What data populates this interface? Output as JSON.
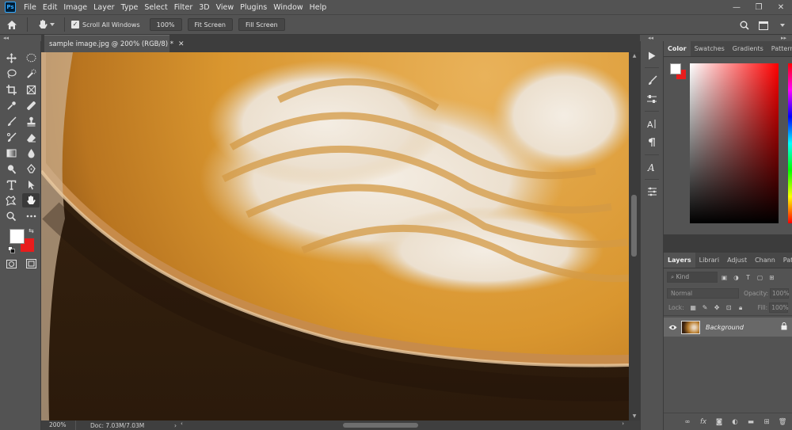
{
  "app": {
    "logo": "Ps"
  },
  "menu": [
    "File",
    "Edit",
    "Image",
    "Layer",
    "Type",
    "Select",
    "Filter",
    "3D",
    "View",
    "Plugins",
    "Window",
    "Help"
  ],
  "window_controls": {
    "minimize": "—",
    "restore": "❐",
    "close": "✕"
  },
  "options": {
    "scroll_all_label": "Scroll All Windows",
    "zoom_100": "100%",
    "fit_screen": "Fit Screen",
    "fill_screen": "Fill Screen"
  },
  "collapse": {
    "left": "◂◂",
    "right": "▸▸"
  },
  "document": {
    "tab_title": "sample image.jpg @ 200% (RGB/8) *",
    "close": "✕"
  },
  "status": {
    "zoom": "200%",
    "doc_info": "Doc: 7.03M/7.03M",
    "arrow": "›"
  },
  "color_panel": {
    "tabs": [
      "Color",
      "Swatches",
      "Gradients",
      "Patterns"
    ],
    "foreground": "#ffffff",
    "background": "#e81c1c"
  },
  "layers_panel": {
    "tabs": [
      "Layers",
      "Librari",
      "Adjust",
      "Chann",
      "Paths"
    ],
    "kind_placeholder": "Kind",
    "blend_mode": "Normal",
    "opacity_label": "Opacity:",
    "opacity_value": "100%",
    "lock_label": "Lock:",
    "fill_label": "Fill:",
    "fill_value": "100%",
    "layer_name": "Background"
  },
  "icons": {
    "home": "home-icon",
    "hand": "hand-icon",
    "search": "search-icon",
    "workspace": "workspace-icon",
    "play": "play-icon",
    "eye": "eye-icon",
    "lock": "lock-icon"
  }
}
